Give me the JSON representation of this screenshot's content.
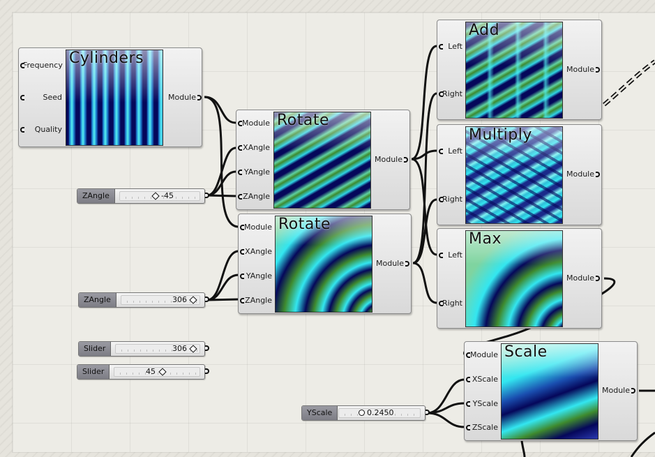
{
  "nodes": {
    "cylinders": {
      "title": "Cylinders",
      "inputs": [
        "Frequency",
        "Seed",
        "Quality"
      ],
      "output": "Module"
    },
    "rotate1": {
      "title": "Rotate",
      "inputs": [
        "Module",
        "XAngle",
        "YAngle",
        "ZAngle"
      ],
      "output": "Module"
    },
    "rotate2": {
      "title": "Rotate",
      "inputs": [
        "Module",
        "XAngle",
        "YAngle",
        "ZAngle"
      ],
      "output": "Module"
    },
    "add": {
      "title": "Add",
      "inputs": [
        "Left",
        "Right"
      ],
      "output": "Module"
    },
    "multiply": {
      "title": "Multiply",
      "inputs": [
        "Left",
        "Right"
      ],
      "output": "Module"
    },
    "max": {
      "title": "Max",
      "inputs": [
        "Left",
        "Right"
      ],
      "output": "Module"
    },
    "scale": {
      "title": "Scale",
      "inputs": [
        "Module",
        "XScale",
        "YScale",
        "ZScale"
      ],
      "output": "Module"
    }
  },
  "sliders": {
    "zangle1": {
      "label": "ZAngle",
      "value": "-45"
    },
    "zangle2": {
      "label": "ZAngle",
      "value": "306"
    },
    "slider1": {
      "label": "Slider",
      "value": "306"
    },
    "slider2": {
      "label": "Slider",
      "value": "45"
    },
    "yscale": {
      "label": "YScale",
      "value": "0.2450"
    }
  },
  "colors": {
    "wire": "#111111",
    "thumb_dark": "#050a5a",
    "thumb_cyan": "#33e6f0",
    "thumb_green": "#3e8a2e"
  }
}
